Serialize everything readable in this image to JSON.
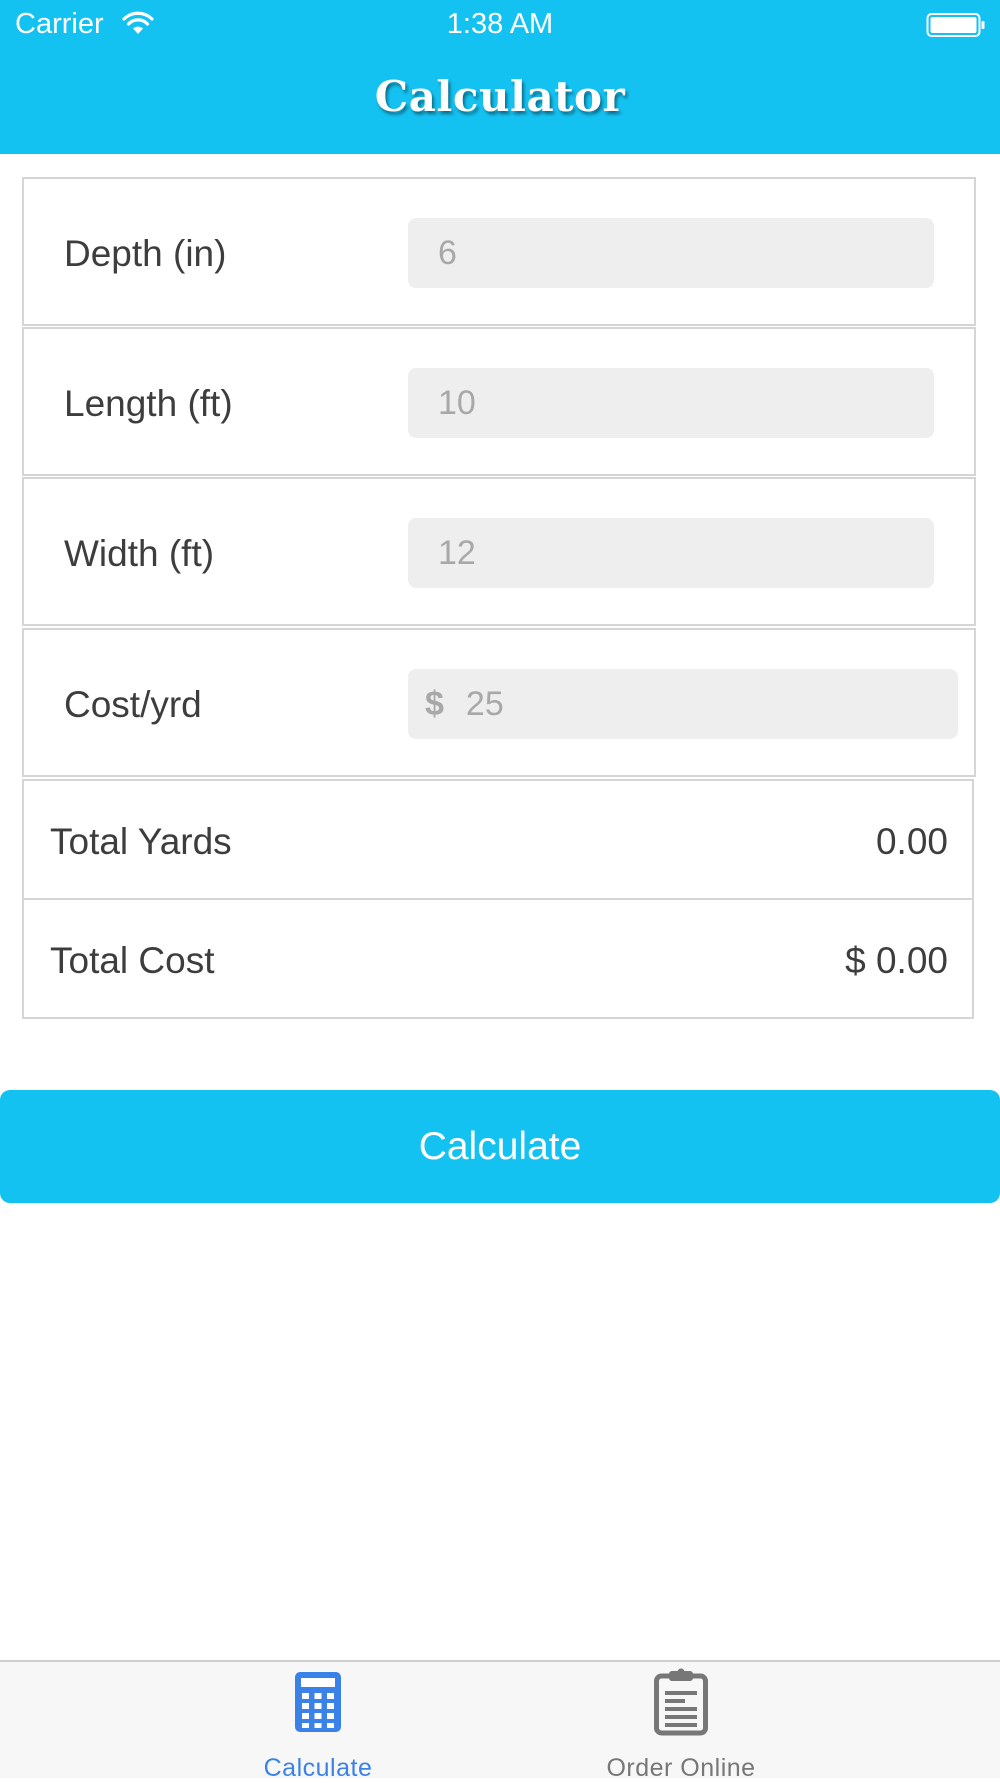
{
  "status_bar": {
    "carrier": "Carrier",
    "time": "1:38 AM"
  },
  "nav": {
    "title": "Calculator"
  },
  "form": {
    "depth": {
      "label": "Depth (in)",
      "placeholder": "6"
    },
    "length": {
      "label": "Length (ft)",
      "placeholder": "10"
    },
    "width": {
      "label": "Width (ft)",
      "placeholder": "12"
    },
    "cost": {
      "label": "Cost/yrd",
      "currency": "$",
      "placeholder": "25"
    }
  },
  "results": {
    "total_yards": {
      "label": "Total Yards",
      "value": "0.00"
    },
    "total_cost": {
      "label": "Total Cost",
      "value": "$ 0.00"
    }
  },
  "calculate_button": {
    "label": "Calculate"
  },
  "tab_bar": {
    "tabs": [
      {
        "label": "Calculate",
        "icon": "calculator-icon",
        "active": true
      },
      {
        "label": "Order Online",
        "icon": "clipboard-icon",
        "active": false
      }
    ]
  },
  "colors": {
    "brand": "#14c2f2",
    "tab_active": "#3b82e8",
    "tab_inactive": "#777777"
  }
}
